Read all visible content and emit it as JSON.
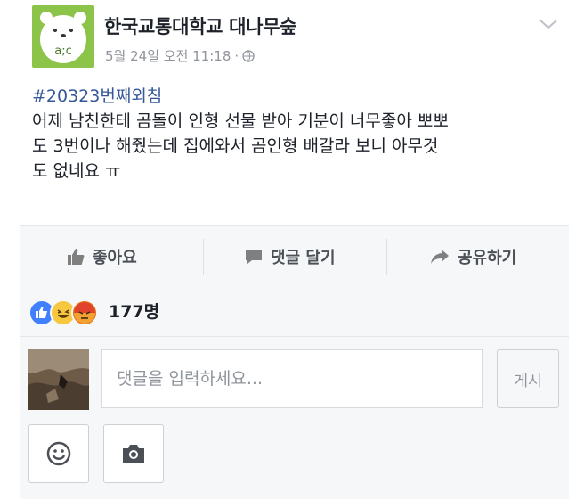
{
  "post": {
    "page_name": "한국교통대학교 대나무숲",
    "timestamp": "5월 24일 오전 11:18",
    "separator": "·",
    "hashtag": "#20323번째외침",
    "text": "어제 남친한테 곰돌이 인형 선물 받아 기분이 너무좋아 뽀뽀\n도 3번이나 해줬는데 집에와서 곰인형 배갈라 보니 아무것\n도 없네요 ㅠ",
    "avatar_text": "a;c"
  },
  "actions": {
    "like": "좋아요",
    "comment": "댓글 달기",
    "share": "공유하기"
  },
  "reactions": {
    "count": "177명",
    "icons": [
      "like-reaction-icon",
      "haha-reaction-icon",
      "angry-reaction-icon"
    ]
  },
  "comment_box": {
    "placeholder": "댓글을 입력하세요...",
    "post_label": "게시"
  },
  "colors": {
    "link": "#365899",
    "brand_green": "#8cc44a",
    "muted": "#90949c",
    "like_blue": "#4080ff"
  }
}
